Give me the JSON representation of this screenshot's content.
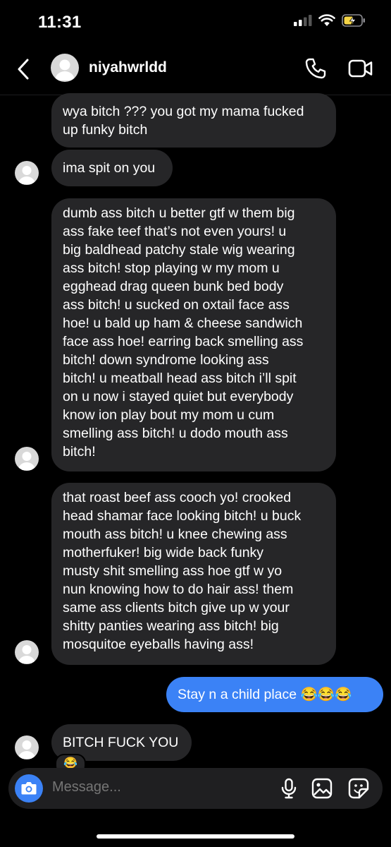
{
  "status": {
    "time": "11:31"
  },
  "header": {
    "username": "niyahwrldd",
    "back_icon": "chevron-left-icon",
    "call_icon": "phone-icon",
    "video_icon": "video-icon"
  },
  "messages": [
    {
      "from": "them",
      "text": "wya bitch ??? you got my mama fucked\nup funky bitch"
    },
    {
      "from": "them",
      "text": "ima spit on you"
    },
    {
      "from": "them",
      "text": "dumb ass bitch u better gtf w them big\nass fake teef that’s not even yours! u\nbig baldhead patchy stale wig wearing\nass bitch! stop playing w my mom u\negghead drag queen bunk bed body\nass bitch! u sucked on oxtail face ass\nhoe! u bald up ham & cheese sandwich\nface ass hoe! earring back smelling ass\nbitch! down syndrome looking ass\nbitch! u meatball head ass bitch i’ll spit\non u now i stayed quiet but everybody\nknow ion play bout my mom u cum\nsmelling ass bitch! u dodo mouth ass\nbitch!"
    },
    {
      "from": "them",
      "text": "that roast beef ass cooch yo! crooked\nhead shamar face looking bitch! u buck\nmouth ass bitch! u knee chewing ass\nmotherfuker! big wide back funky\nmusty shit smelling ass hoe gtf w yo\nnun knowing how to do hair ass! them\nsame ass clients bitch give up w your\nshitty panties wearing ass bitch! big\nmosquitoe eyeballs having ass!"
    },
    {
      "from": "me",
      "text": "Stay n a child place 😂😂😂"
    },
    {
      "from": "them",
      "text": "BITCH FUCK YOU",
      "reaction": "😂"
    }
  ],
  "composer": {
    "placeholder": "Message...",
    "camera_icon": "camera-icon",
    "mic_icon": "microphone-icon",
    "gallery_icon": "image-icon",
    "sticker_icon": "sticker-icon"
  },
  "colors": {
    "background": "#000000",
    "incoming_bubble": "#262628",
    "outgoing_bubble": "#3b82f6",
    "battery": "#f5d547"
  }
}
